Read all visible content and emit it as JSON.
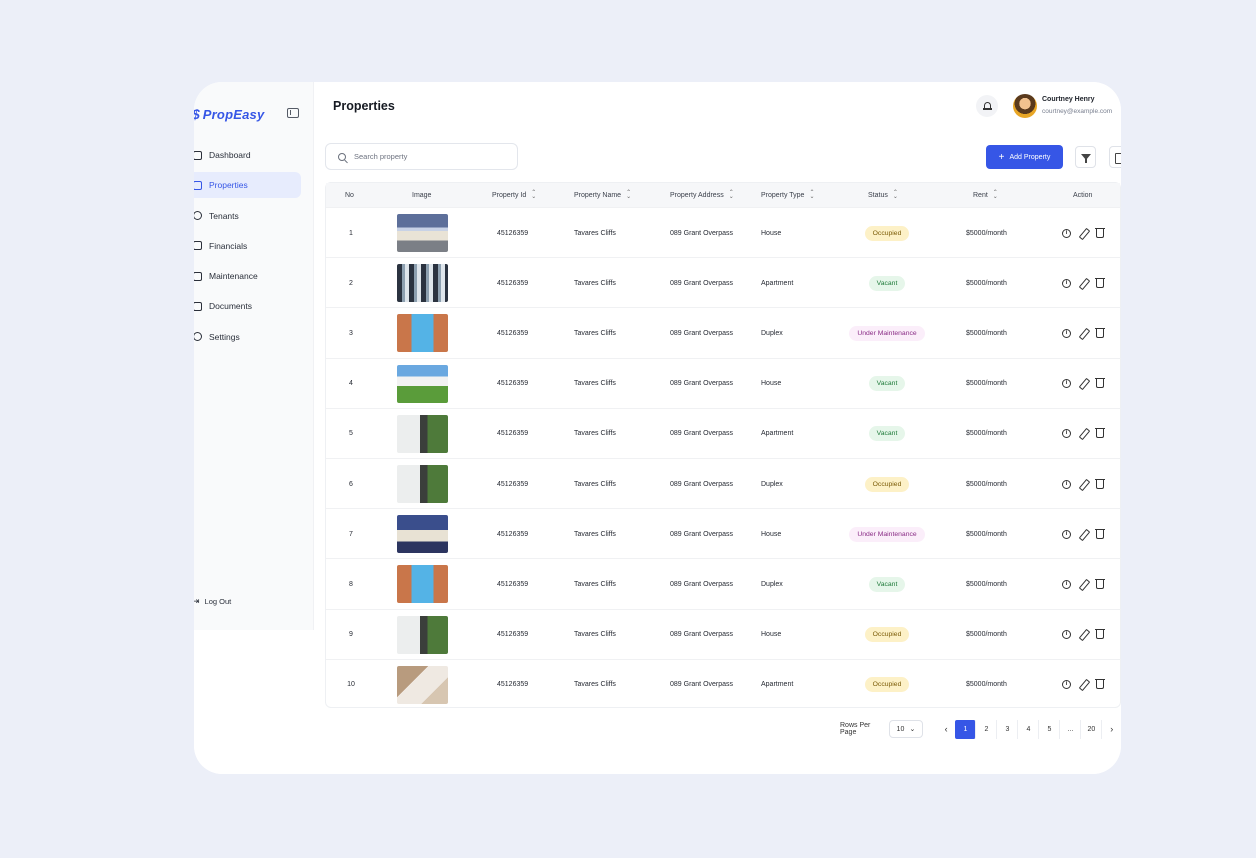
{
  "app": {
    "logo_mark": "$",
    "logo_text": "PropEasy",
    "page_title": "Properties"
  },
  "user": {
    "name": "Courtney Henry",
    "email": "courtney@example.com"
  },
  "sidebar": {
    "items": [
      {
        "label": "Dashboard",
        "icon": "dashboard-icon",
        "active": false
      },
      {
        "label": "Properties",
        "icon": "home-icon",
        "active": true
      },
      {
        "label": "Tenants",
        "icon": "user-icon",
        "active": false
      },
      {
        "label": "Financials",
        "icon": "financials-icon",
        "active": false
      },
      {
        "label": "Maintenance",
        "icon": "hammer-icon",
        "active": false
      },
      {
        "label": "Documents",
        "icon": "document-icon",
        "active": false
      },
      {
        "label": "Settings",
        "icon": "gear-icon",
        "active": false
      }
    ],
    "logout_label": "Log Out"
  },
  "toolbar": {
    "search_placeholder": "Search property",
    "add_label": "Add Property"
  },
  "table": {
    "headers": {
      "no": "No",
      "image": "Image",
      "property_id": "Property Id",
      "property_name": "Property Name",
      "property_address": "Property Address",
      "property_type": "Property Type",
      "status": "Status",
      "rent": "Rent",
      "action": "Action"
    },
    "rows": [
      {
        "no": "1",
        "id": "45126359",
        "name": "Tavares Cliffs",
        "address": "089 Grant Overpass",
        "type": "House",
        "status": "Occupied",
        "rent": "$5000/month",
        "img": "house-dusk"
      },
      {
        "no": "2",
        "id": "45126359",
        "name": "Tavares Cliffs",
        "address": "089 Grant Overpass",
        "type": "Apartment",
        "status": "Vacant",
        "rent": "$5000/month",
        "img": "tower-glass"
      },
      {
        "no": "3",
        "id": "45126359",
        "name": "Tavares Cliffs",
        "address": "089 Grant Overpass",
        "type": "Duplex",
        "status": "Under Maintenance",
        "rent": "$5000/month",
        "img": "twin-towers"
      },
      {
        "no": "4",
        "id": "45126359",
        "name": "Tavares Cliffs",
        "address": "089 Grant Overpass",
        "type": "House",
        "status": "Vacant",
        "rent": "$5000/month",
        "img": "villa-lawn"
      },
      {
        "no": "5",
        "id": "45126359",
        "name": "Tavares Cliffs",
        "address": "089 Grant Overpass",
        "type": "Apartment",
        "status": "Vacant",
        "rent": "$5000/month",
        "img": "modern-white"
      },
      {
        "no": "6",
        "id": "45126359",
        "name": "Tavares Cliffs",
        "address": "089 Grant Overpass",
        "type": "Duplex",
        "status": "Occupied",
        "rent": "$5000/month",
        "img": "modern-white"
      },
      {
        "no": "7",
        "id": "45126359",
        "name": "Tavares Cliffs",
        "address": "089 Grant Overpass",
        "type": "House",
        "status": "Under Maintenance",
        "rent": "$5000/month",
        "img": "house-blue"
      },
      {
        "no": "8",
        "id": "45126359",
        "name": "Tavares Cliffs",
        "address": "089 Grant Overpass",
        "type": "Duplex",
        "status": "Vacant",
        "rent": "$5000/month",
        "img": "twin-towers"
      },
      {
        "no": "9",
        "id": "45126359",
        "name": "Tavares Cliffs",
        "address": "089 Grant Overpass",
        "type": "House",
        "status": "Occupied",
        "rent": "$5000/month",
        "img": "modern-white"
      },
      {
        "no": "10",
        "id": "45126359",
        "name": "Tavares Cliffs",
        "address": "089 Grant Overpass",
        "type": "Apartment",
        "status": "Occupied",
        "rent": "$5000/month",
        "img": "keys-hand"
      }
    ]
  },
  "status_colors": {
    "Occupied": {
      "bg": "#fdf1c7",
      "fg": "#7a5a06"
    },
    "Vacant": {
      "bg": "#e6f6ea",
      "fg": "#1f7a3a"
    },
    "Under Maintenance": {
      "bg": "#fbeefa",
      "fg": "#8a2c86"
    }
  },
  "pagination": {
    "rows_per_page_label": "Rows Per Page",
    "rows_per_page_value": "10",
    "pages": [
      "1",
      "2",
      "3",
      "4",
      "5",
      "...",
      "20"
    ],
    "current": "1"
  },
  "colors": {
    "accent": "#3656e6",
    "background": "#eceff8"
  }
}
